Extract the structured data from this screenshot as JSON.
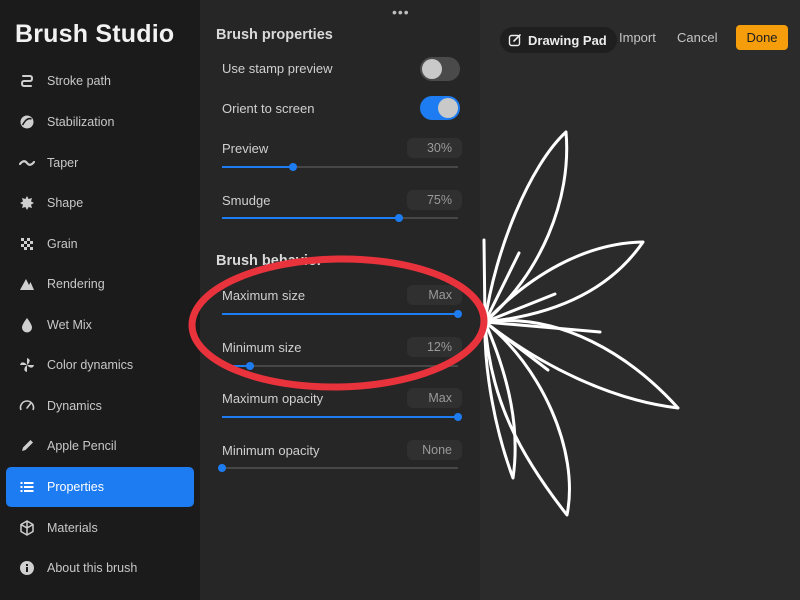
{
  "app": {
    "title": "Brush Studio"
  },
  "sidebar": {
    "items": [
      {
        "label": "Stroke path",
        "icon": "stroke-path-icon"
      },
      {
        "label": "Stabilization",
        "icon": "stabilization-icon"
      },
      {
        "label": "Taper",
        "icon": "taper-icon"
      },
      {
        "label": "Shape",
        "icon": "shape-icon"
      },
      {
        "label": "Grain",
        "icon": "grain-icon"
      },
      {
        "label": "Rendering",
        "icon": "rendering-icon"
      },
      {
        "label": "Wet Mix",
        "icon": "wet-mix-icon"
      },
      {
        "label": "Color dynamics",
        "icon": "color-dynamics-icon"
      },
      {
        "label": "Dynamics",
        "icon": "dynamics-icon"
      },
      {
        "label": "Apple Pencil",
        "icon": "apple-pencil-icon"
      },
      {
        "label": "Properties",
        "icon": "properties-icon",
        "active": true
      },
      {
        "label": "Materials",
        "icon": "materials-icon"
      },
      {
        "label": "About this brush",
        "icon": "about-icon"
      }
    ]
  },
  "panel": {
    "brush_properties_title": "Brush properties",
    "use_stamp_preview": {
      "label": "Use stamp preview",
      "enabled": false
    },
    "orient_to_screen": {
      "label": "Orient to screen",
      "enabled": true
    },
    "preview": {
      "label": "Preview",
      "value": "30%",
      "fraction": 0.3
    },
    "smudge": {
      "label": "Smudge",
      "value": "75%",
      "fraction": 0.75
    },
    "brush_behavior_title": "Brush behavior",
    "maximum_size": {
      "label": "Maximum size",
      "value": "Max",
      "fraction": 1.0
    },
    "minimum_size": {
      "label": "Minimum size",
      "value": "12%",
      "fraction": 0.12
    },
    "maximum_opacity": {
      "label": "Maximum opacity",
      "value": "Max",
      "fraction": 1.0
    },
    "minimum_opacity": {
      "label": "Minimum opacity",
      "value": "None",
      "fraction": 0.0
    }
  },
  "canvas_toolbar": {
    "drawing_pad_label": "Drawing Pad",
    "import_label": "Import",
    "cancel_label": "Cancel",
    "done_label": "Done"
  },
  "colors": {
    "accent": "#1e7cf2",
    "done_button": "#f59d0b",
    "highlight_circle": "#e8323c"
  }
}
